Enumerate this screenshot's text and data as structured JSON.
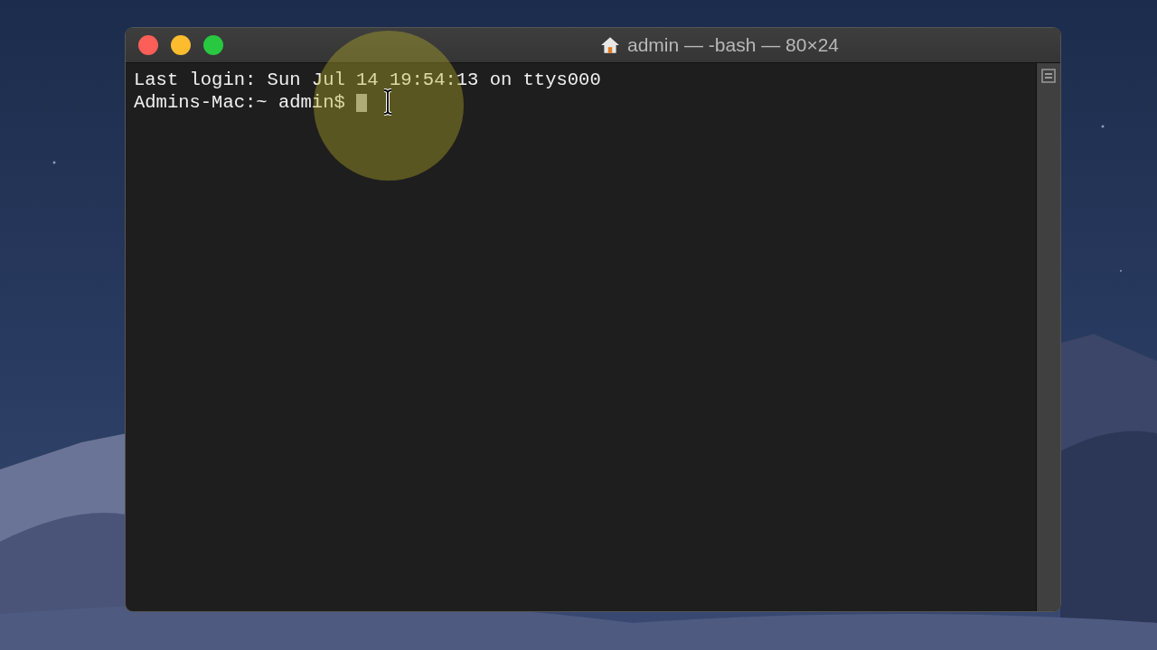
{
  "window": {
    "title": "admin — -bash — 80×24"
  },
  "terminal": {
    "lines": [
      {
        "kind": "output",
        "text": "Last login: Sun Jul 14 19:54:13 on ttys000"
      },
      {
        "kind": "prompt",
        "text": "Admins-Mac:~ admin$"
      }
    ]
  }
}
